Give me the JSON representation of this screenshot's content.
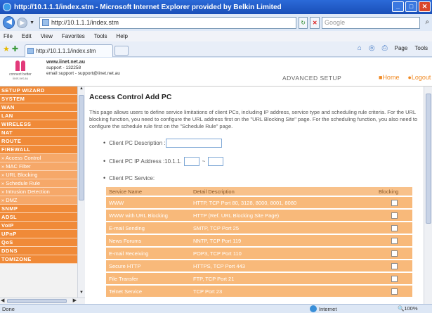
{
  "window": {
    "title": "http://10.1.1.1/index.stm - Microsoft Internet Explorer provided by Belkin Limited",
    "address": "http://10.1.1.1/index.stm",
    "search_placeholder": "Google",
    "tab_title": "http://10.1.1.1/index.stm",
    "menu": [
      "File",
      "Edit",
      "View",
      "Favorites",
      "Tools",
      "Help"
    ],
    "commands": [
      "Page",
      "Tools"
    ]
  },
  "header": {
    "logo_text": "connect better",
    "logo_sub": "iinet.net.au",
    "contact_site": "www.iinet.net.au",
    "contact_support": "support - 132258",
    "contact_email": "email support - support@iinet.net.au",
    "mode": "ADVANCED SETUP",
    "home_link": "Home",
    "logout_link": "Logout"
  },
  "sidebar": {
    "items": [
      {
        "label": "SETUP WIZARD",
        "sub": false
      },
      {
        "label": "SYSTEM",
        "sub": false
      },
      {
        "label": "WAN",
        "sub": false
      },
      {
        "label": "LAN",
        "sub": false
      },
      {
        "label": "WIRELESS",
        "sub": false
      },
      {
        "label": "NAT",
        "sub": false
      },
      {
        "label": "ROUTE",
        "sub": false
      },
      {
        "label": "FIREWALL",
        "sub": false
      },
      {
        "label": "» Access Control",
        "sub": true
      },
      {
        "label": "» MAC Filter",
        "sub": true
      },
      {
        "label": "» URL Blocking",
        "sub": true
      },
      {
        "label": "» Schedule Rule",
        "sub": true
      },
      {
        "label": "» Intrusion Detection",
        "sub": true
      },
      {
        "label": "» DMZ",
        "sub": true
      },
      {
        "label": "SNMP",
        "sub": false
      },
      {
        "label": "ADSL",
        "sub": false
      },
      {
        "label": "VoIP",
        "sub": false
      },
      {
        "label": "UPnP",
        "sub": false
      },
      {
        "label": "QoS",
        "sub": false
      },
      {
        "label": "DDNS",
        "sub": false
      },
      {
        "label": "TOMIZONE",
        "sub": false
      }
    ]
  },
  "main": {
    "title": "Access Control Add PC",
    "intro": "This page allows users to define service limitations of client PCs, including IP address, service type and scheduling rule criteria. For the URL blocking function, you need to configure the URL address first on the \"URL Blocking Site\" page. For the scheduling function, you also need to configure the schedule rule first on the \"Schedule Rule\" page.",
    "desc_label": "Client PC Description :",
    "desc_value": "",
    "ip_label": "Client PC IP Address :10.1.1.",
    "ip_separator": "~",
    "ip_from": "",
    "ip_to": "",
    "service_label": "Client PC Service:",
    "table": {
      "headers": [
        "Service Name",
        "Detail Description",
        "Blocking"
      ],
      "rows": [
        {
          "name": "WWW",
          "detail": "HTTP, TCP Port 80, 3128, 8000, 8001, 8080",
          "blocked": false
        },
        {
          "name": "WWW with URL Blocking",
          "detail": "HTTP (Ref. URL Blocking Site Page)",
          "blocked": false
        },
        {
          "name": "E-mail Sending",
          "detail": "SMTP, TCP Port 25",
          "blocked": false
        },
        {
          "name": "News Forums",
          "detail": "NNTP, TCP Port 119",
          "blocked": false
        },
        {
          "name": "E-mail Receiving",
          "detail": "POP3, TCP Port 110",
          "blocked": false
        },
        {
          "name": "Secure HTTP",
          "detail": "HTTPS, TCP Port 443",
          "blocked": false
        },
        {
          "name": "File Transfer",
          "detail": "FTP, TCP Port 21",
          "blocked": false
        },
        {
          "name": "Telnet Service",
          "detail": "TCP Port 23",
          "blocked": false
        }
      ]
    }
  },
  "status": {
    "left": "Done",
    "zone": "Internet",
    "zoom": "100%"
  },
  "colors": {
    "nav_main": "#f08a38",
    "nav_sub": "#f6a869",
    "table_row": "#f8b97a",
    "link": "#f08a24"
  }
}
